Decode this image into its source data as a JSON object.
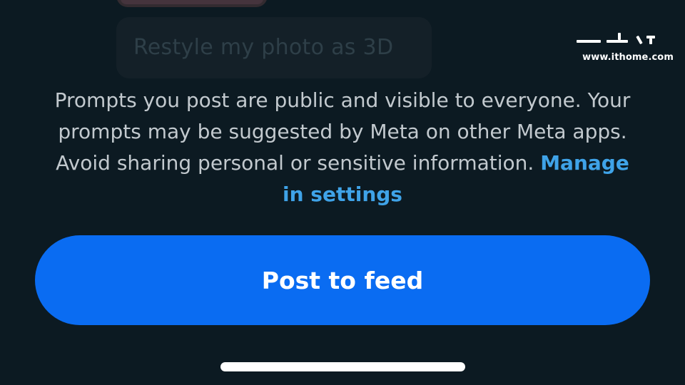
{
  "prompt_suggestion": {
    "label": "Restyle my photo as 3D"
  },
  "notice": {
    "text": "Prompts you post are public and visible to everyone. Your prompts may be suggested by Meta on other Meta apps. Avoid sharing personal or sensitive information. ",
    "link_label": "Manage in settings"
  },
  "actions": {
    "post_button_label": "Post to feed"
  },
  "watermark": {
    "text": "www.ithome.com"
  },
  "colors": {
    "background": "#0c1a22",
    "primary_button": "#0a6cf2",
    "link": "#3fa3e8",
    "body_text": "#c2c9ce"
  }
}
